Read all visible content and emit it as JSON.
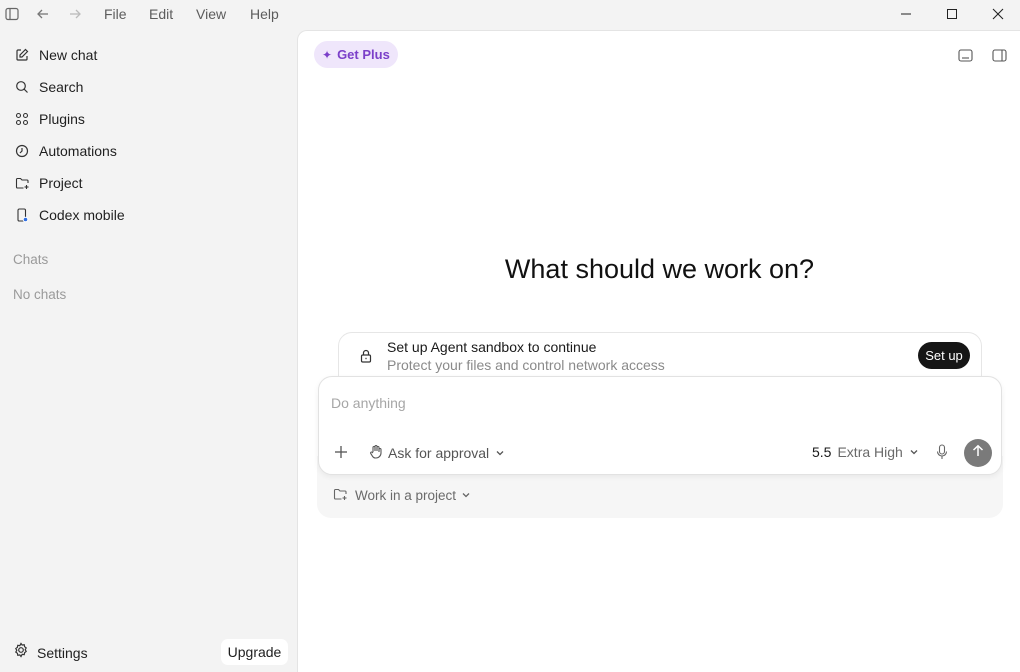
{
  "titlebar": {
    "menus": [
      "File",
      "Edit",
      "View",
      "Help"
    ]
  },
  "sidebar": {
    "items": [
      {
        "label": "New chat",
        "icon": "edit-icon"
      },
      {
        "label": "Search",
        "icon": "search-icon"
      },
      {
        "label": "Plugins",
        "icon": "grid-icon"
      },
      {
        "label": "Automations",
        "icon": "clock-icon"
      },
      {
        "label": "Project",
        "icon": "folder-icon"
      },
      {
        "label": "Codex mobile",
        "icon": "phone-icon"
      }
    ],
    "chats_header": "Chats",
    "chats_empty": "No chats",
    "settings_label": "Settings",
    "upgrade_label": "Upgrade"
  },
  "main": {
    "get_plus_label": "Get Plus",
    "headline": "What should we work on?",
    "sandbox": {
      "title": "Set up Agent sandbox to continue",
      "subtitle": "Protect your files and control network access",
      "button": "Set up"
    },
    "composer": {
      "placeholder": "Do anything",
      "approval_label": "Ask for approval",
      "model_version": "5.5",
      "model_effort": "Extra High"
    },
    "project_label": "Work in a project"
  },
  "colors": {
    "accent_purple": "#7b3fc9",
    "get_plus_bg": "#efe6fb",
    "send_button": "#7a7a7a",
    "setup_button": "#161616"
  }
}
